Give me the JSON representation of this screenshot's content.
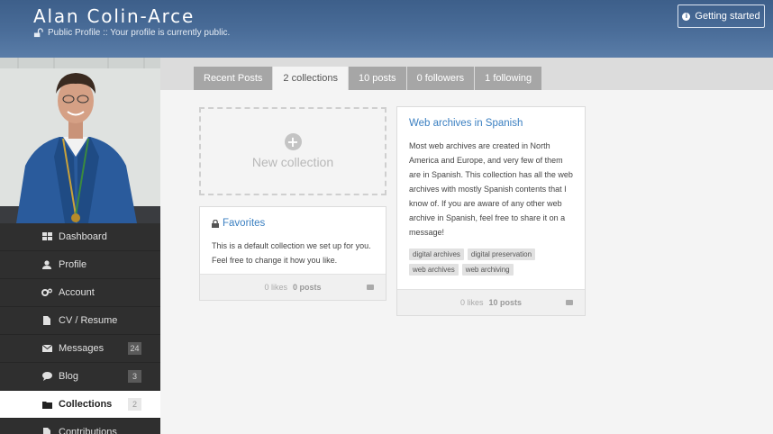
{
  "header": {
    "name": "Alan Colin-Arce",
    "status_line": "Public Profile :: Your profile is currently public.",
    "getting_started_label": "Getting started"
  },
  "tabs": [
    {
      "label": "Recent Posts",
      "active": false
    },
    {
      "label": "2 collections",
      "active": true
    },
    {
      "label": "10 posts",
      "active": false
    },
    {
      "label": "0 followers",
      "active": false
    },
    {
      "label": "1 following",
      "active": false
    }
  ],
  "sidebar": {
    "items": [
      {
        "label": "Dashboard",
        "icon": "grid-icon",
        "badge": ""
      },
      {
        "label": "Profile",
        "icon": "user-icon",
        "badge": ""
      },
      {
        "label": "Account",
        "icon": "gears-icon",
        "badge": ""
      },
      {
        "label": "CV / Resume",
        "icon": "file-icon",
        "badge": ""
      },
      {
        "label": "Messages",
        "icon": "envelope-icon",
        "badge": "24"
      },
      {
        "label": "Blog",
        "icon": "comment-icon",
        "badge": "3"
      },
      {
        "label": "Collections",
        "icon": "folder-icon",
        "badge": "2",
        "active": true
      },
      {
        "label": "Contributions",
        "icon": "file-icon",
        "badge": ""
      }
    ]
  },
  "new_collection": {
    "label": "New collection"
  },
  "favorites": {
    "title": "Favorites",
    "description": "This is a default collection we set up for you. Feel free to change it how you like.",
    "likes": "0 likes",
    "posts": "0 posts"
  },
  "spanish": {
    "title": "Web archives in Spanish",
    "description": "Most web archives are created in North America and Europe, and very few of them are in Spanish. This collection has all the web archives with mostly Spanish contents that I know of. If you are aware of any other web archive in Spanish, feel free to share it on a message!",
    "tags": [
      "digital archives",
      "digital preservation",
      "web archives",
      "web archiving"
    ],
    "likes": "0 likes",
    "posts": "10 posts"
  },
  "colors": {
    "header": "#4a6d99",
    "link": "#3a7fc1",
    "sidebar": "#2f2f2f",
    "tab": "#a6a6a6"
  }
}
